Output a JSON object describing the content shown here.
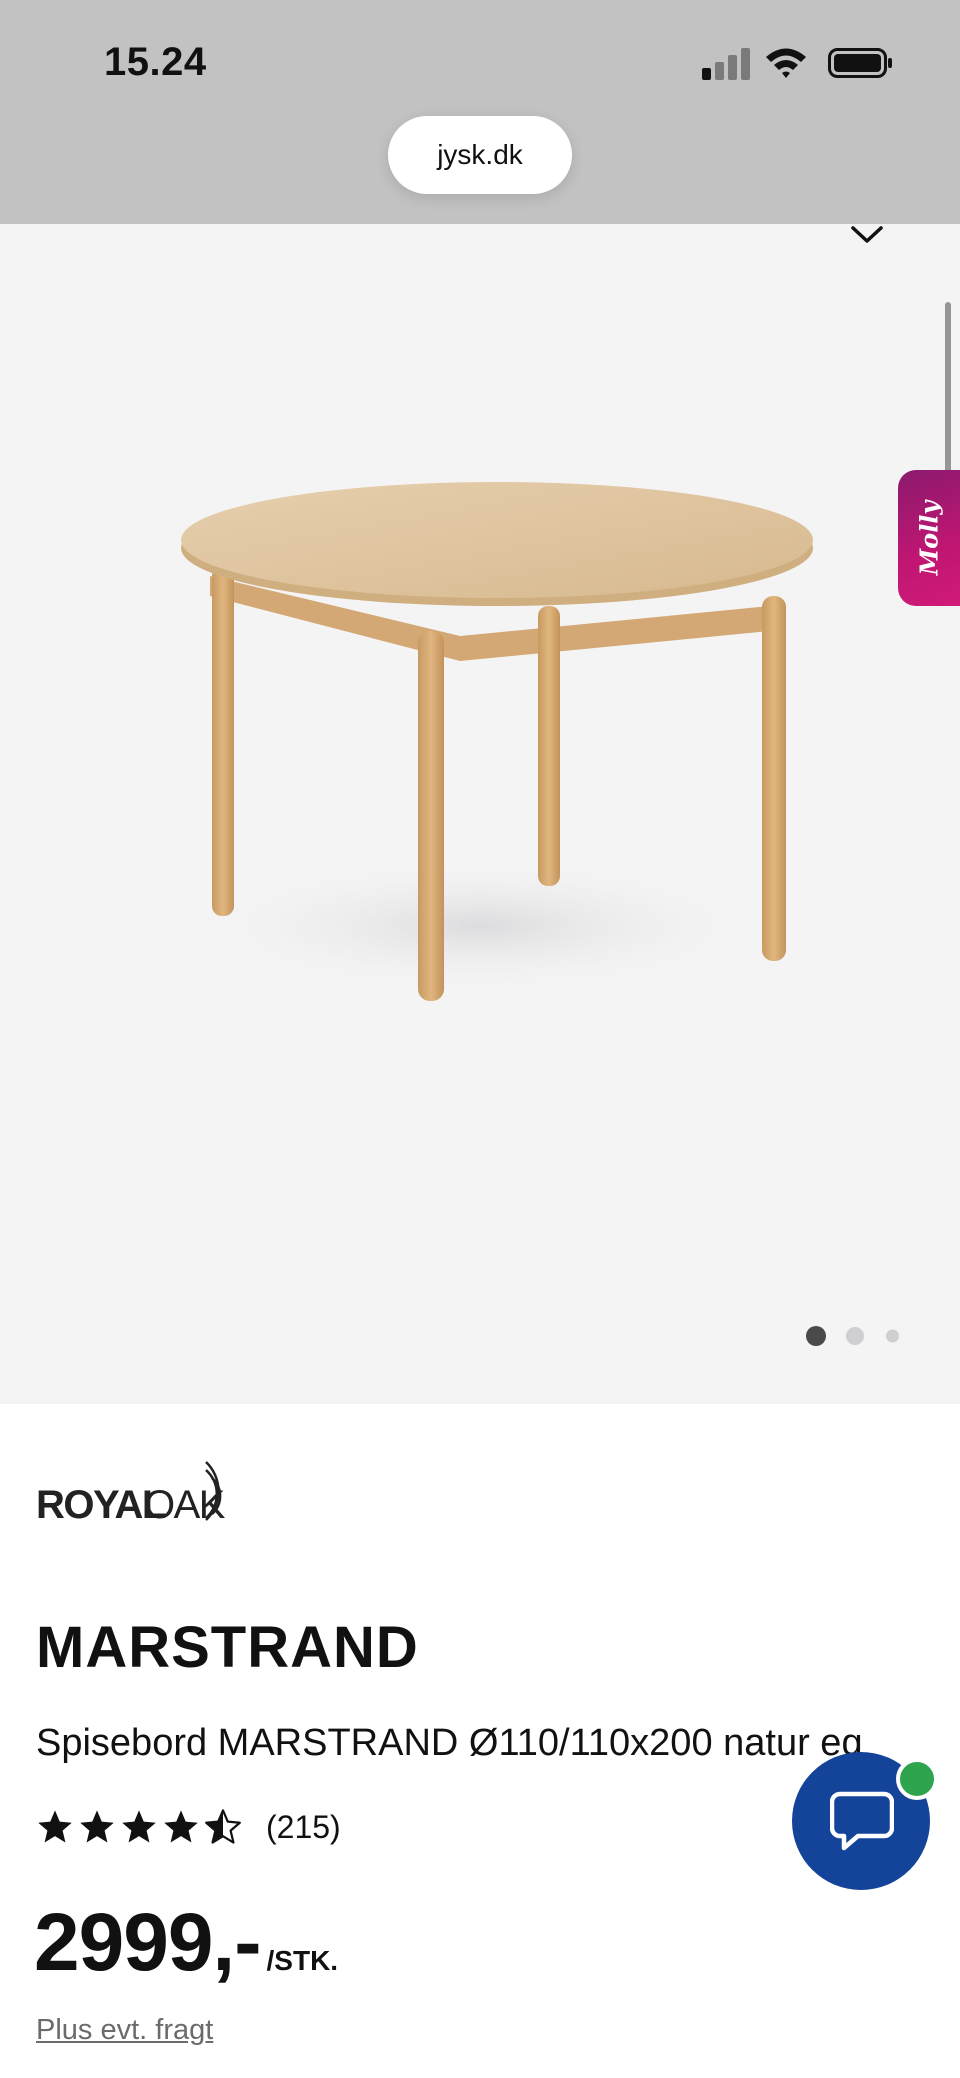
{
  "status_bar": {
    "time": "15.24",
    "signal_bars_active": 1,
    "signal_bars_total": 4
  },
  "browser": {
    "url": "jysk.dk"
  },
  "gallery": {
    "image_count": 3,
    "active_index": 0,
    "side_tab_label": "Molly",
    "side_tab_color": "#c01672"
  },
  "product": {
    "brand": "ROYAL OAK",
    "name": "MARSTRAND",
    "description": "Spisebord MARSTRAND Ø110/110x200 natur eg",
    "rating": 4.5,
    "rating_max": 5,
    "review_count": "(215)",
    "price": "2999,-",
    "price_unit": "/STK.",
    "shipping_note": "Plus evt. fragt"
  },
  "colors": {
    "chat_button": "#14439a",
    "online_indicator": "#2ea44f",
    "gallery_bg": "#f4f4f5"
  },
  "icons": {
    "collapse": "chevron-down-icon",
    "chat": "chat-bubble-icon"
  }
}
